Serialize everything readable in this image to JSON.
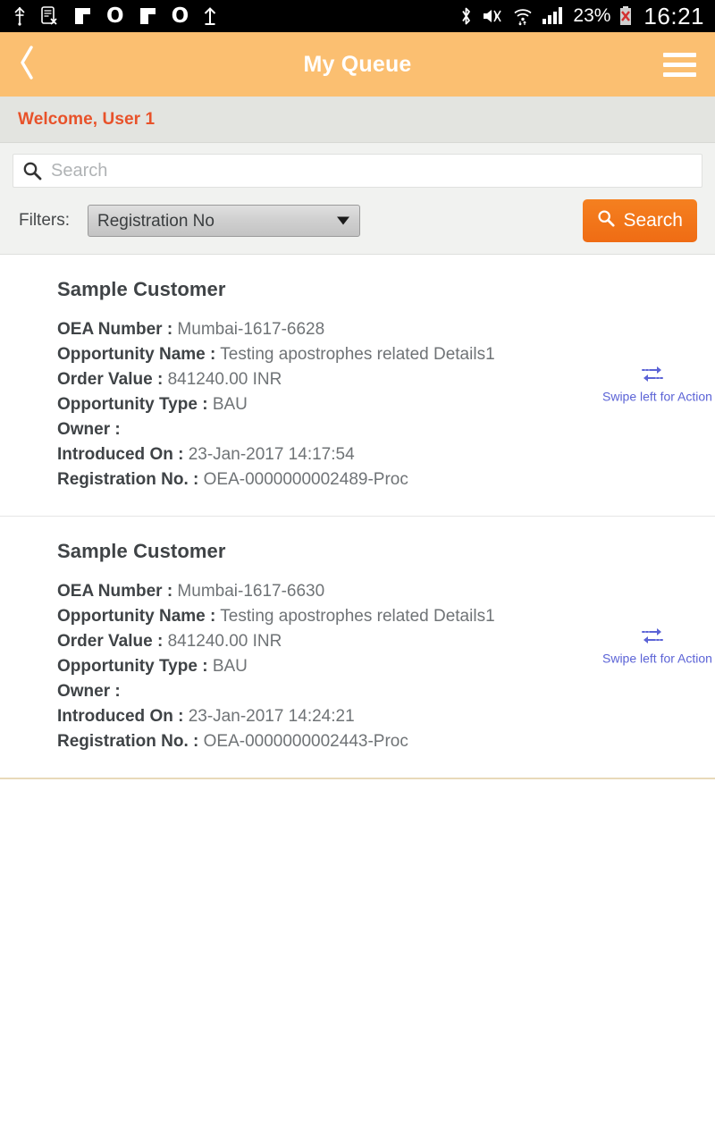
{
  "status_bar": {
    "left_icons": [
      {
        "name": "usb-icon",
        "glyph": "Ψ"
      },
      {
        "name": "sim-card-error-icon",
        "glyph": "▤"
      },
      {
        "name": "network-block-icon-1",
        "glyph": "▐"
      },
      {
        "name": "network-o-icon-1",
        "glyph": "O"
      },
      {
        "name": "network-block-icon-2",
        "glyph": "▐"
      },
      {
        "name": "network-o-icon-2",
        "glyph": "O"
      },
      {
        "name": "upload-arrow-icon",
        "glyph": "↑"
      }
    ],
    "bluetooth_icon": "bluetooth-icon",
    "mute_icon": "volume-mute-icon",
    "wifi_icon": "wifi-data-icon",
    "signal_icon": "signal-bars-icon",
    "battery_percent": "23%",
    "battery_icon": "battery-error-icon",
    "clock": "16:21"
  },
  "header": {
    "back_icon": "back-chevron-icon",
    "title": "My Queue",
    "menu_icon": "hamburger-menu-icon"
  },
  "welcome": {
    "text": "Welcome, User 1"
  },
  "search": {
    "icon": "search-icon",
    "value": "",
    "placeholder": "Search"
  },
  "filters": {
    "label": "Filters:",
    "selected": "Registration No",
    "options": [
      "Registration No"
    ],
    "dropdown_icon": "chevron-down-icon",
    "search_button": {
      "icon": "search-icon",
      "label": "Search"
    }
  },
  "colors": {
    "header_orange": "#fbbf71",
    "accent_orange": "#ef6c14",
    "welcome_text": "#e8522a",
    "swipe_link": "#5b63d6",
    "welcome_bg": "#e3e4e0",
    "panel_bg": "#f1f2f0"
  },
  "field_labels": {
    "oea_number": "OEA Number :",
    "opportunity_name": "Opportunity Name :",
    "order_value": "Order Value :",
    "opportunity_type": "Opportunity Type :",
    "owner": "Owner :",
    "introduced_on": "Introduced On :",
    "registration_no": "Registration No. :"
  },
  "swipe_hint": {
    "icon": "swipe-arrows-icon",
    "text": "Swipe left for Action"
  },
  "results": [
    {
      "customer": "Sample Customer",
      "oea_number": "Mumbai-1617-6628",
      "opportunity_name": "Testing apostrophes related Details1",
      "order_value": "841240.00 INR",
      "opportunity_type": "BAU",
      "owner": "",
      "introduced_on": "23-Jan-2017 14:17:54",
      "registration_no": "OEA-0000000002489-Proc"
    },
    {
      "customer": "Sample Customer",
      "oea_number": "Mumbai-1617-6630",
      "opportunity_name": "Testing apostrophes related Details1",
      "order_value": "841240.00 INR",
      "opportunity_type": "BAU",
      "owner": "",
      "introduced_on": "23-Jan-2017 14:24:21",
      "registration_no": "OEA-0000000002443-Proc"
    }
  ]
}
